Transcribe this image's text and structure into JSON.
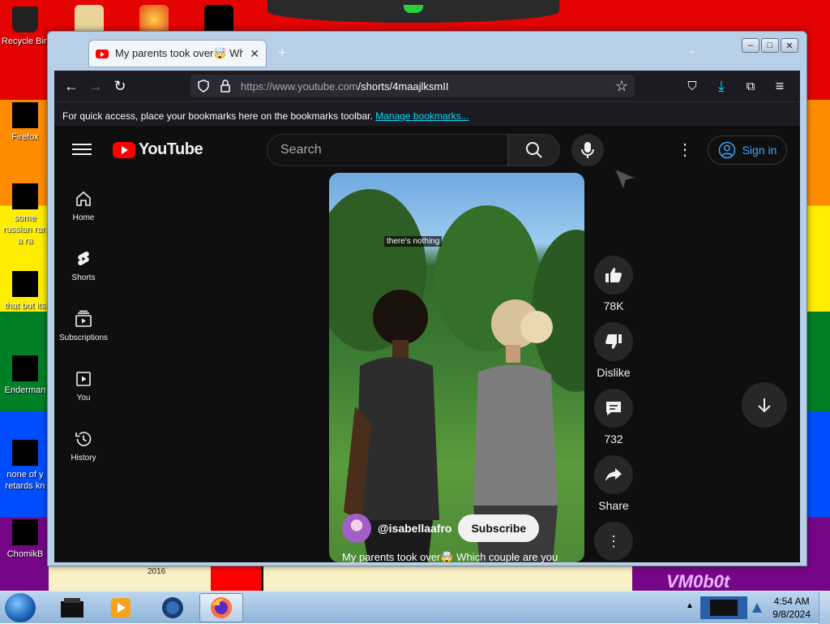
{
  "desktop": {
    "icons": [
      "Recycle Bin",
      "Firefox",
      "some russian ran a ra",
      "that but its",
      "Enderman",
      "none of y retards kn",
      "ChomikB"
    ],
    "overlay_year": "2016",
    "watermark": "VM0b0t"
  },
  "browser": {
    "tab_title": "My parents took over🤯 Which",
    "url_host": "https://www.youtube.com",
    "url_path": "/shorts/4maajlksmII",
    "bookmarks_message": "For quick access, place your bookmarks here on the bookmarks toolbar.",
    "bookmarks_link": "Manage bookmarks..."
  },
  "youtube": {
    "logo_text": "YouTube",
    "search_placeholder": "Search",
    "sign_in": "Sign in",
    "sidebar": [
      {
        "label": "Home",
        "icon": "home-icon"
      },
      {
        "label": "Shorts",
        "icon": "shorts-icon"
      },
      {
        "label": "Subscriptions",
        "icon": "subscriptions-icon"
      },
      {
        "label": "You",
        "icon": "you-icon"
      },
      {
        "label": "History",
        "icon": "history-icon"
      }
    ],
    "video": {
      "caption": "there's nothing",
      "channel": "@isabellaafro",
      "subscribe": "Subscribe",
      "title": "My parents took over🤯 Which couple are you"
    },
    "actions": {
      "likes": "78K",
      "dislike": "Dislike",
      "comments": "732",
      "share": "Share"
    }
  },
  "taskbar": {
    "time": "4:54 AM",
    "date": "9/8/2024"
  },
  "colors": {
    "yt_red": "#ff0000",
    "yt_bg": "#0f0f0f",
    "signin_blue": "#3ea6ff",
    "link_cyan": "#00ddff"
  }
}
